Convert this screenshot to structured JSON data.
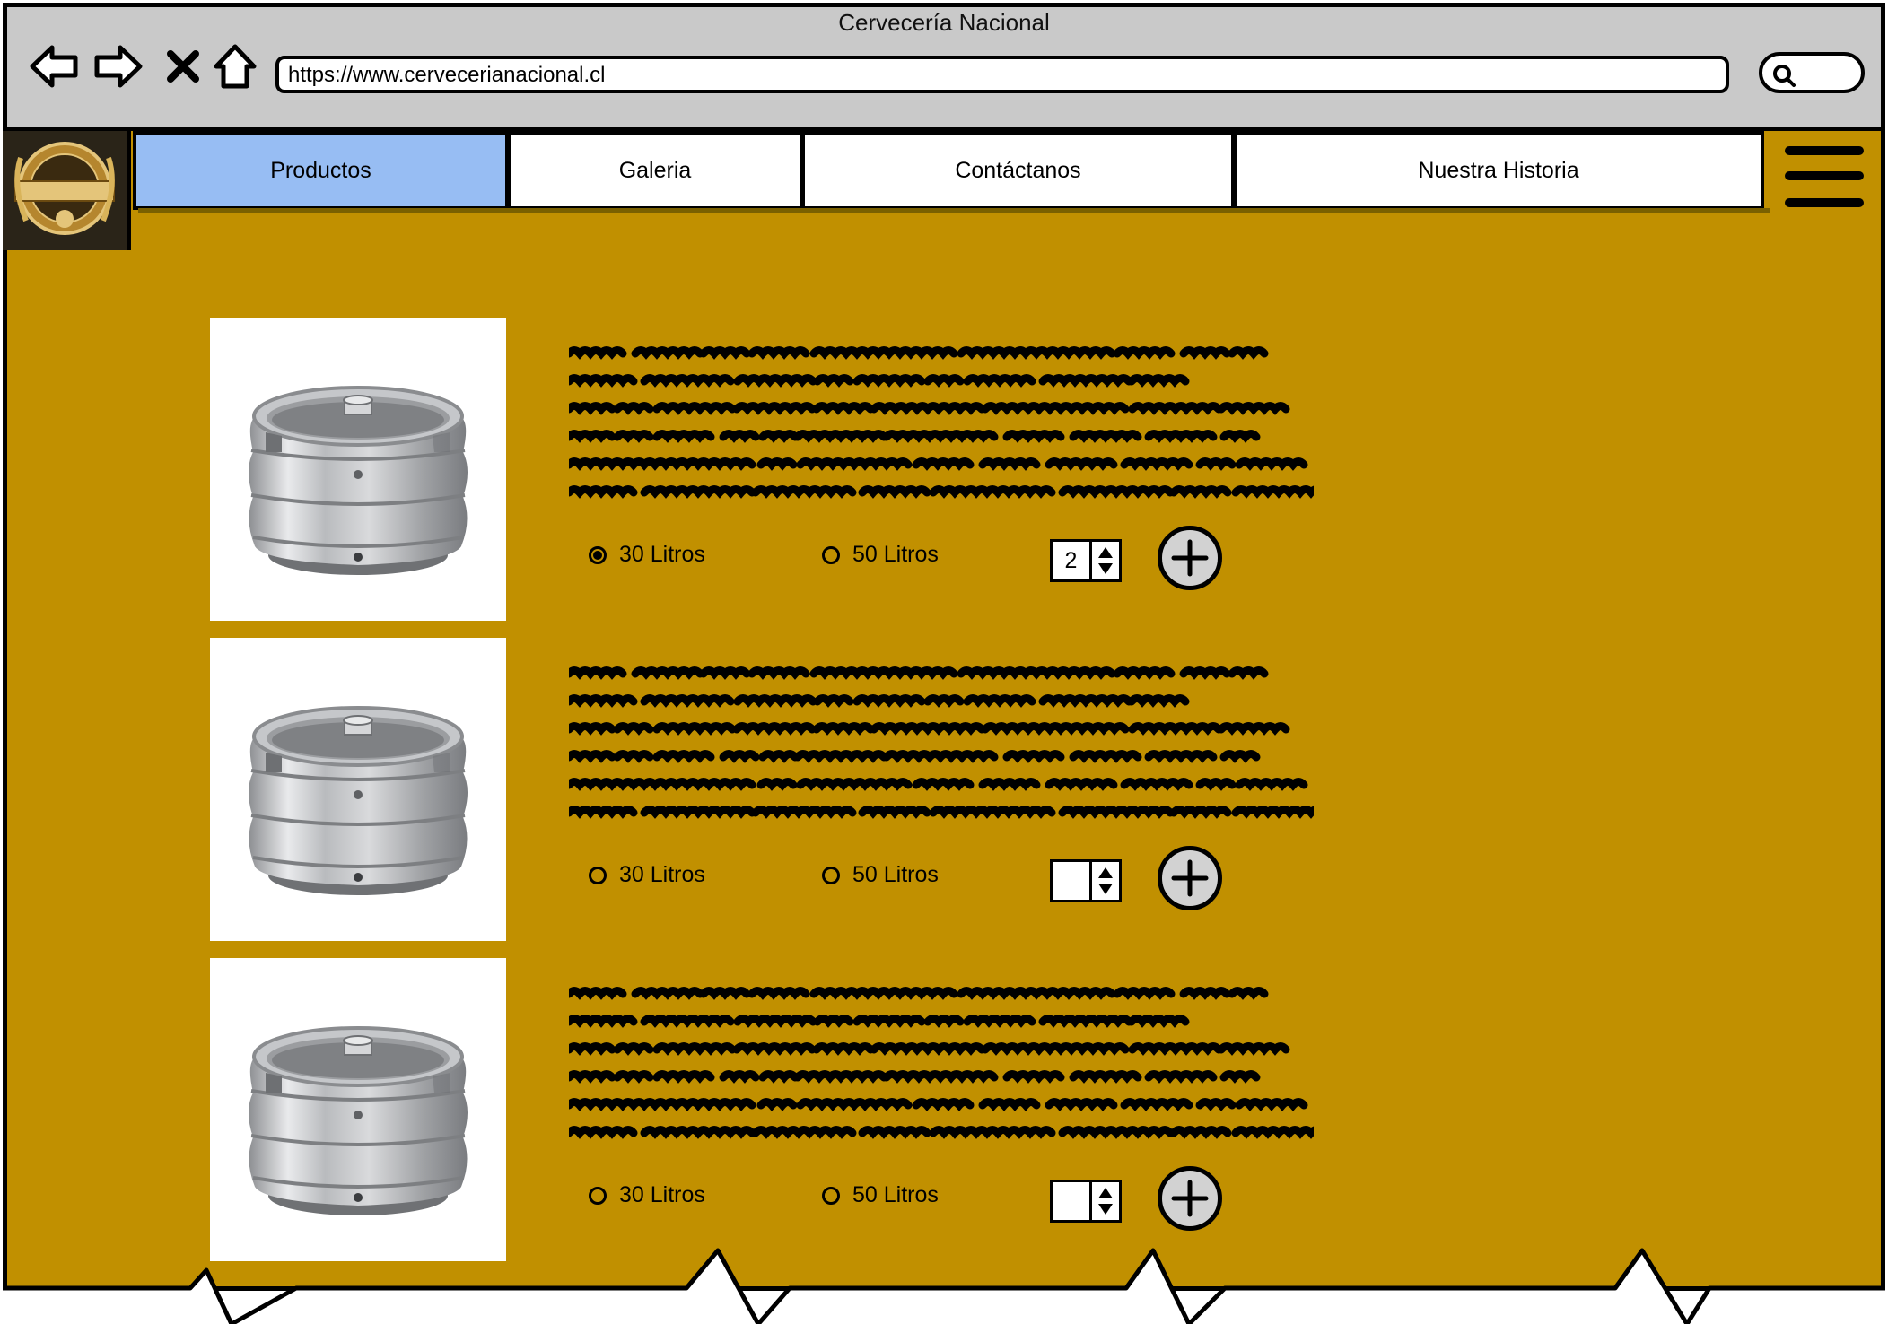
{
  "window": {
    "title": "Cervecería Nacional"
  },
  "browser": {
    "url": "https://www.cervecerianacional.cl"
  },
  "nav": {
    "tabs": [
      {
        "label": "Productos",
        "active": true
      },
      {
        "label": "Galeria"
      },
      {
        "label": "Contáctanos"
      },
      {
        "label": "Nuestra Historia"
      }
    ]
  },
  "products": [
    {
      "option_a": "30 Litros",
      "option_b": "50 Litros",
      "selected": "30 Litros",
      "quantity": "2"
    },
    {
      "option_a": "30 Litros",
      "option_b": "50 Litros",
      "selected": "",
      "quantity": ""
    },
    {
      "option_a": "30 Litros",
      "option_b": "50 Litros",
      "selected": "",
      "quantity": ""
    }
  ],
  "colors": {
    "page_bg": "#c19000",
    "active_tab": "#97bdf3",
    "chrome": "#c9c9c9"
  },
  "icons": [
    "back-arrow-icon",
    "forward-arrow-icon",
    "close-icon",
    "home-icon",
    "search-icon",
    "hamburger-menu-icon",
    "keg-image",
    "plus-icon"
  ]
}
